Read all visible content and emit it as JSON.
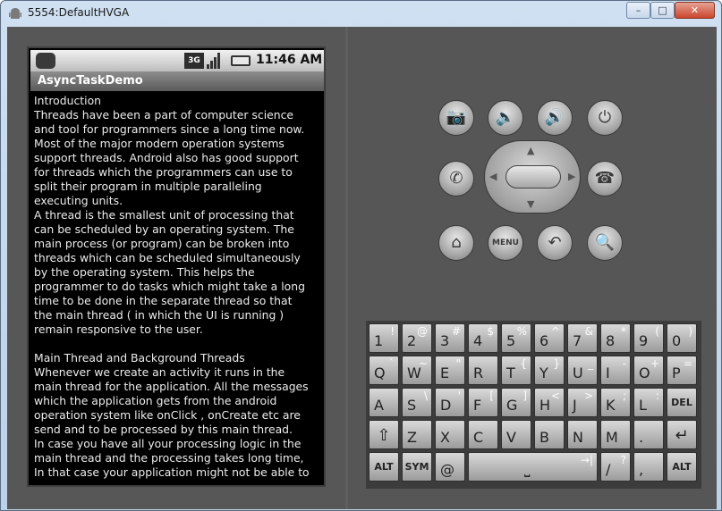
{
  "window": {
    "title": "5554:DefaultHVGA",
    "controls": {
      "minimize": "–",
      "maximize": "□",
      "close": "✕"
    }
  },
  "device": {
    "status": {
      "network": "3G",
      "time": "11:46 AM"
    },
    "app_title": "AsyncTaskDemo",
    "content": "Introduction\nThreads have been a part of computer science\nand tool for programmers since a long time now.\nMost of the major modern operation systems\nsupport threads. Android also has good support\nfor threads which the programmers can use to\nsplit their program in multiple paralleling\nexecuting units.\nA thread is the smallest unit of processing that\ncan be scheduled by an operating system. The\nmain process (or program) can be broken into\nthreads which can be scheduled simultaneously\nby the operating system. This helps the\nprogrammer to do tasks which might take a long\ntime to be done in the separate thread so that\nthe main thread ( in which the UI is running )\nremain responsive to the user.\n\nMain Thread and Background Threads\nWhenever we create an activity it runs in the\nmain thread for the application. All the messages\nwhich the application gets from the android\noperation system like onClick , onCreate etc are\nsend and to be processed by this main thread.\nIn case you have all your processing logic in the\nmain thread and the processing takes long time,\nIn that case your application might not be able to"
  },
  "hardware_buttons": {
    "camera": "📷",
    "volume_down": "🔈",
    "volume_up": "🔊",
    "power": "⏻",
    "call": "✆",
    "end_call": "☎",
    "home": "⌂",
    "menu": "MENU",
    "back": "↶",
    "search": "🔍"
  },
  "keyboard": {
    "row1": [
      {
        "main": "1",
        "sub": "!"
      },
      {
        "main": "2",
        "sub": "@"
      },
      {
        "main": "3",
        "sub": "#"
      },
      {
        "main": "4",
        "sub": "$"
      },
      {
        "main": "5",
        "sub": "%"
      },
      {
        "main": "6",
        "sub": "^"
      },
      {
        "main": "7",
        "sub": "&"
      },
      {
        "main": "8",
        "sub": "*"
      },
      {
        "main": "9",
        "sub": "("
      },
      {
        "main": "0",
        "sub": ")"
      }
    ],
    "row2": [
      {
        "main": "Q",
        "sub": "`"
      },
      {
        "main": "W",
        "sub": "~"
      },
      {
        "main": "E",
        "sub": "\""
      },
      {
        "main": "R",
        "sub": ""
      },
      {
        "main": "T",
        "sub": "{"
      },
      {
        "main": "Y",
        "sub": "}"
      },
      {
        "main": "U",
        "sub": "_"
      },
      {
        "main": "I",
        "sub": "-"
      },
      {
        "main": "O",
        "sub": "+"
      },
      {
        "main": "P",
        "sub": "="
      }
    ],
    "row3": [
      {
        "main": "A",
        "sub": ""
      },
      {
        "main": "S",
        "sub": "\\"
      },
      {
        "main": "D",
        "sub": "'"
      },
      {
        "main": "F",
        "sub": "["
      },
      {
        "main": "G",
        "sub": "]"
      },
      {
        "main": "H",
        "sub": "<"
      },
      {
        "main": "J",
        "sub": ">"
      },
      {
        "main": "K",
        "sub": ";"
      },
      {
        "main": "L",
        "sub": ":"
      },
      {
        "main": "DEL",
        "sub": ""
      }
    ],
    "row4": [
      {
        "main": "⇧",
        "sub": ""
      },
      {
        "main": "Z",
        "sub": ""
      },
      {
        "main": "X",
        "sub": ""
      },
      {
        "main": "C",
        "sub": ""
      },
      {
        "main": "V",
        "sub": ""
      },
      {
        "main": "B",
        "sub": ""
      },
      {
        "main": "N",
        "sub": ""
      },
      {
        "main": "M",
        "sub": ""
      },
      {
        "main": ".",
        "sub": ""
      },
      {
        "main": "↵",
        "sub": ""
      }
    ],
    "row5": {
      "alt_left": "ALT",
      "sym": "SYM",
      "at": "@",
      "space": "⎵",
      "tab": "→|",
      "slash": "/",
      "question": "?",
      "comma": ",",
      "alt_right": "ALT"
    }
  }
}
